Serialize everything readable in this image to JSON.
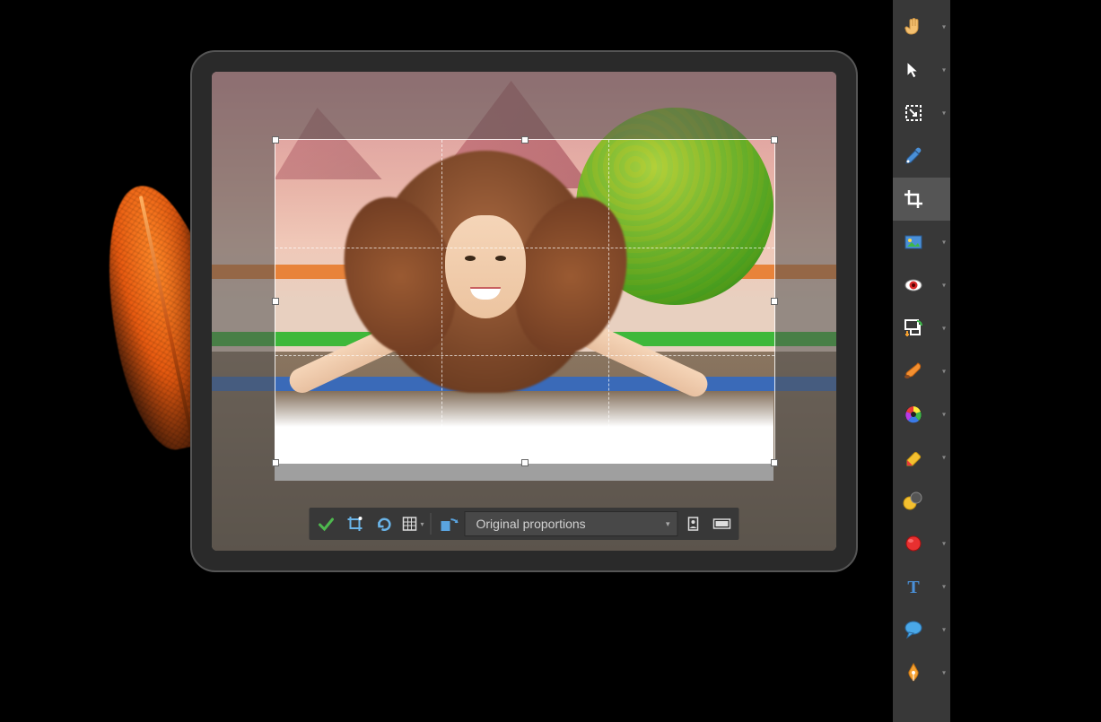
{
  "bottomToolbar": {
    "applyLabel": "Apply",
    "cropLabel": "Crop",
    "resetLabel": "Reset",
    "gridLabel": "Grid",
    "rotateLabel": "Rotate",
    "proportionsLabel": "Original proportions",
    "portraitLabel": "Portrait",
    "landscapeLabel": "Landscape"
  },
  "sidebar": {
    "tools": [
      {
        "name": "hand-tool",
        "icon": "hand",
        "hasDropdown": true,
        "active": false
      },
      {
        "name": "pointer-tool",
        "icon": "pointer",
        "hasDropdown": true,
        "active": false
      },
      {
        "name": "selection-tool",
        "icon": "selection",
        "hasDropdown": true,
        "active": false
      },
      {
        "name": "eyedropper-tool",
        "icon": "eyedropper",
        "hasDropdown": false,
        "active": false
      },
      {
        "name": "crop-tool",
        "icon": "crop",
        "hasDropdown": false,
        "active": true
      },
      {
        "name": "image-tool",
        "icon": "image",
        "hasDropdown": true,
        "active": false
      },
      {
        "name": "redeye-tool",
        "icon": "redeye",
        "hasDropdown": true,
        "active": false
      },
      {
        "name": "stamp-tool",
        "icon": "stamp",
        "hasDropdown": true,
        "active": false
      },
      {
        "name": "brush-tool",
        "icon": "brush",
        "hasDropdown": true,
        "active": false
      },
      {
        "name": "colorwheel-tool",
        "icon": "colorwheel",
        "hasDropdown": true,
        "active": false
      },
      {
        "name": "eraser-tool",
        "icon": "eraser",
        "hasDropdown": true,
        "active": false
      },
      {
        "name": "swap-tool",
        "icon": "swap",
        "hasDropdown": false,
        "active": false
      },
      {
        "name": "circle-tool",
        "icon": "circle",
        "hasDropdown": true,
        "active": false
      },
      {
        "name": "text-tool",
        "icon": "text",
        "hasDropdown": true,
        "active": false
      },
      {
        "name": "callout-tool",
        "icon": "callout",
        "hasDropdown": true,
        "active": false
      },
      {
        "name": "pen-tool",
        "icon": "pen",
        "hasDropdown": true,
        "active": false
      }
    ]
  },
  "colors": {
    "accent": "#ff7a18",
    "toolbar": "#383838",
    "active": "#555555"
  }
}
